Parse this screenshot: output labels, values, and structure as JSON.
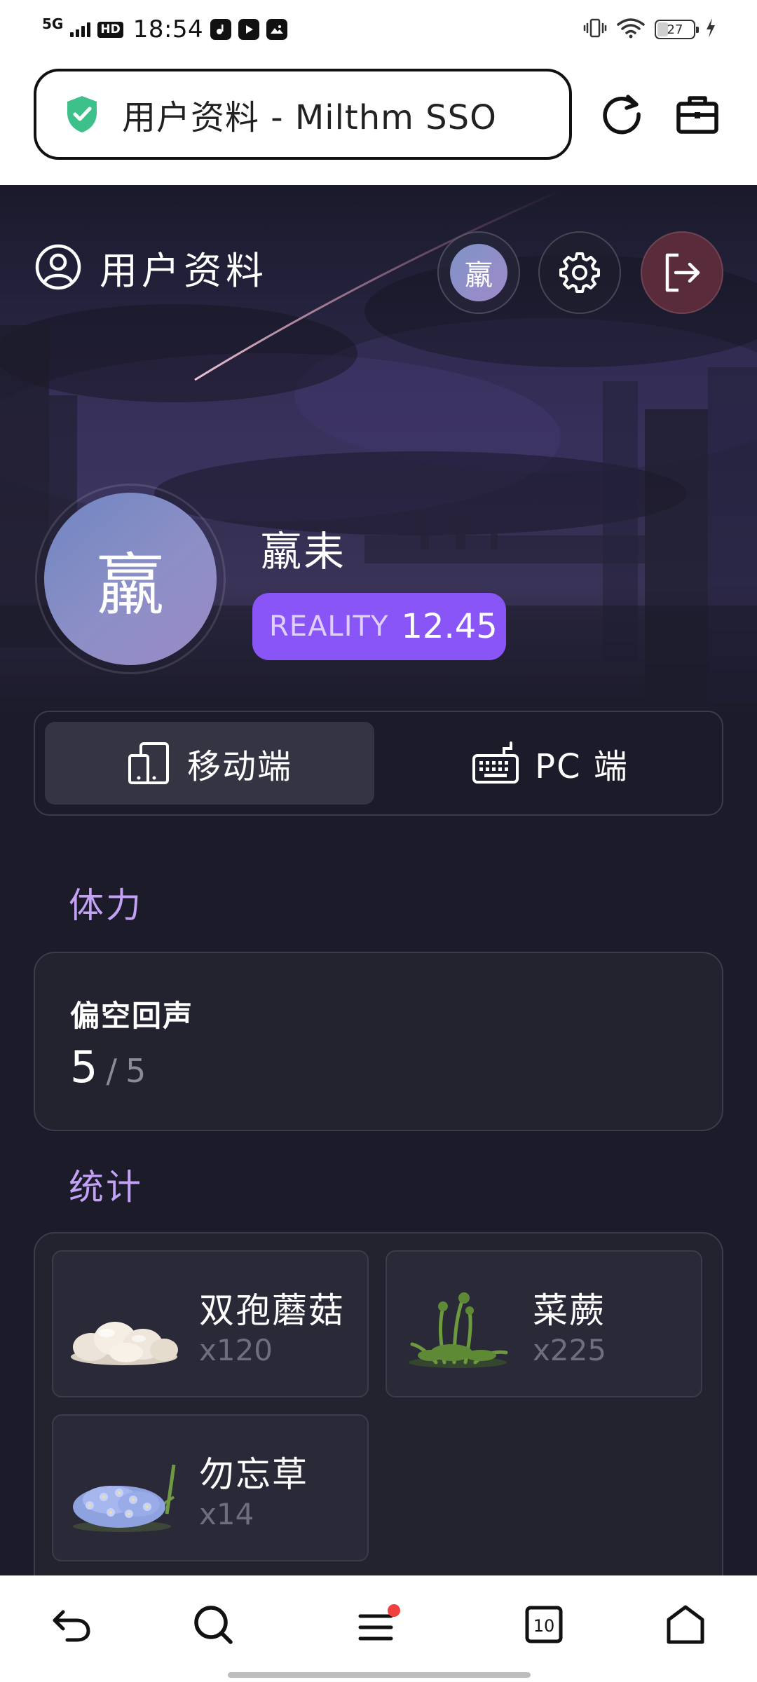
{
  "status_bar": {
    "network": "5G",
    "hd": "HD",
    "time": "18:54",
    "battery": "27",
    "battery_level": 0.27
  },
  "browser": {
    "url_title": "用户资料 - Milthm SSO",
    "icons": [
      "shield-check-icon",
      "refresh-icon",
      "toolbox-icon"
    ]
  },
  "header": {
    "title": "用户资料",
    "avatar_char": "羸",
    "icons": [
      "user-circle-icon",
      "settings-icon",
      "logout-icon"
    ]
  },
  "profile": {
    "avatar_char": "羸",
    "username": "羸耒",
    "reality_label": "REALITY",
    "reality_value": "12.45"
  },
  "platform_tabs": [
    {
      "label": "移动端",
      "icon": "mobile-icon",
      "selected": true
    },
    {
      "label": "PC 端",
      "icon": "keyboard-icon",
      "selected": false
    }
  ],
  "stamina": {
    "section_title": "体力",
    "name": "偏空回声",
    "current": "5",
    "separator": "/",
    "max": "5"
  },
  "stats": {
    "section_title": "统计",
    "items": [
      {
        "name": "双孢蘑菇",
        "qty": "x120",
        "icon": "mushroom-image"
      },
      {
        "name": "菜蕨",
        "qty": "x225",
        "icon": "fern-image"
      },
      {
        "name": "勿忘草",
        "qty": "x14",
        "icon": "forget-me-not-image"
      }
    ]
  },
  "bottom_nav": {
    "tabs_count": "10",
    "icons": [
      "back-icon",
      "search-icon",
      "menu-icon",
      "tabs-icon",
      "home-icon"
    ]
  },
  "colors": {
    "accent": "#8a55f7",
    "section_title": "#c3a2f6",
    "page_bg": "#1c1b29",
    "logout_bg": "#5a2b3b"
  }
}
